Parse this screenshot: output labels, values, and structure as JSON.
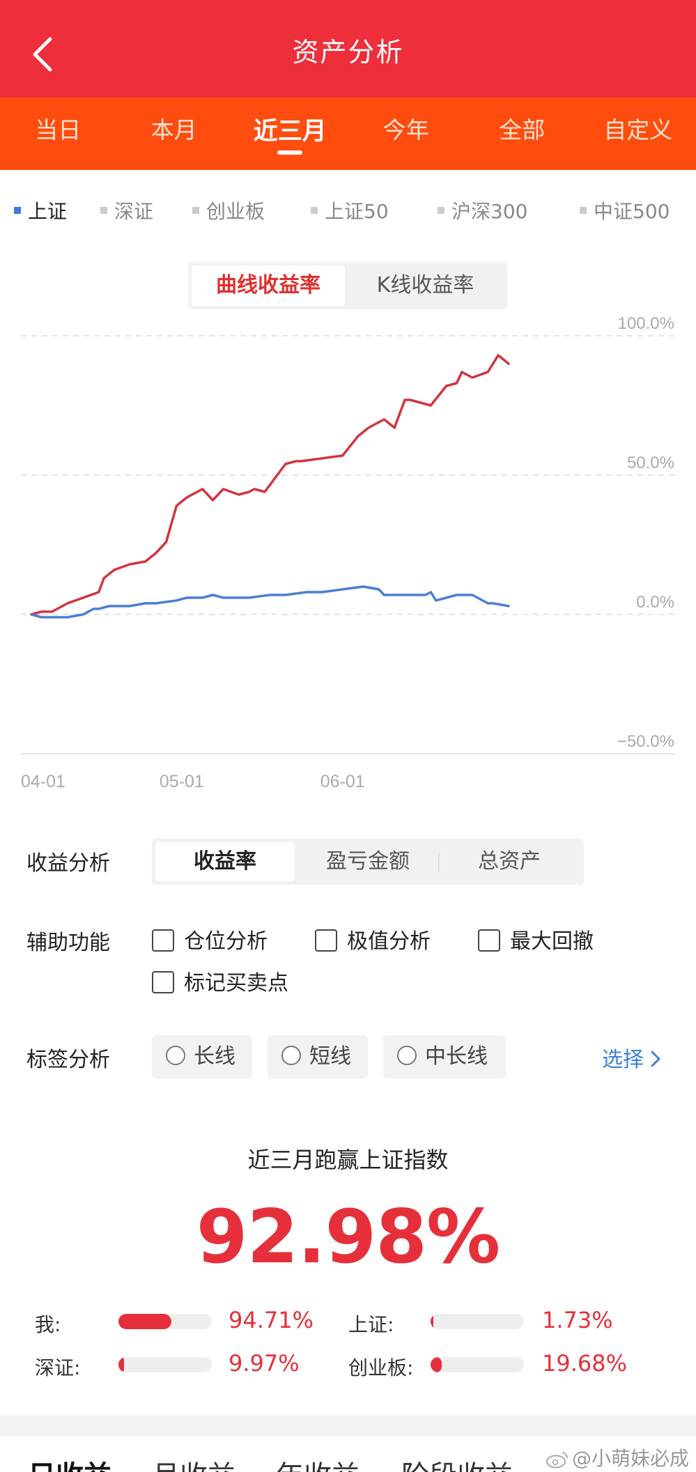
{
  "header": {
    "title": "资产分析"
  },
  "period_tabs": [
    "当日",
    "本月",
    "近三月",
    "今年",
    "全部",
    "自定义"
  ],
  "period_active": 2,
  "index_tabs": [
    "上证",
    "深证",
    "创业板",
    "上证50",
    "沪深300",
    "中证500"
  ],
  "index_active": 0,
  "chart_toggle": {
    "curve": "曲线收益率",
    "kline": "K线收益率"
  },
  "chart_data": {
    "type": "line",
    "y_tick_labels": [
      "100.0%",
      "50.0%",
      "0.0%",
      "−50.0%"
    ],
    "y_ticks": [
      100,
      50,
      0,
      -50
    ],
    "ylim": [
      -50,
      100
    ],
    "x_tick_labels": [
      "04-01",
      "05-01",
      "06-01"
    ],
    "x_ticks": [
      0,
      31,
      62
    ],
    "xlim": [
      0,
      94
    ],
    "grid": true,
    "series": [
      {
        "color": "#d2343f",
        "x": [
          2,
          4,
          6,
          9,
          12,
          15,
          16,
          18,
          21,
          24,
          26,
          27,
          28,
          30,
          32,
          35,
          37,
          39,
          42,
          44,
          45,
          47,
          51,
          53,
          54,
          58,
          62,
          65,
          67,
          70,
          72,
          74,
          75,
          77,
          79,
          82,
          84,
          85,
          87,
          90,
          92,
          94
        ],
        "y": [
          0,
          1,
          1,
          4,
          6,
          8,
          13,
          16,
          18,
          19,
          22,
          24,
          26,
          39,
          42,
          45,
          41,
          45,
          43,
          44,
          45,
          44,
          54,
          55,
          55,
          56,
          57,
          64,
          67,
          70,
          67,
          77,
          77,
          76,
          75,
          82,
          83,
          87,
          85,
          87,
          93,
          90
        ]
      },
      {
        "color": "#4a7fd0",
        "x": [
          2,
          4,
          6,
          9,
          12,
          14,
          15,
          17,
          21,
          24,
          26,
          30,
          32,
          35,
          37,
          39,
          42,
          44,
          48,
          51,
          55,
          58,
          62,
          66,
          69,
          70,
          72,
          74,
          78,
          79,
          80,
          82,
          84,
          87,
          90,
          91,
          94
        ],
        "y": [
          0,
          -1,
          -1,
          -1,
          0,
          2,
          2,
          3,
          3,
          4,
          4,
          5,
          6,
          6,
          7,
          6,
          6,
          6,
          7,
          7,
          8,
          8,
          9,
          10,
          9,
          7,
          7,
          7,
          7,
          8,
          5,
          6,
          7,
          7,
          4,
          4,
          3
        ]
      },
      {
        "color": "#4a7fd0",
        "x": [
          72,
          78,
          84,
          90,
          94
        ],
        "y": [
          7,
          7,
          7,
          4,
          3
        ]
      }
    ]
  },
  "analysis": {
    "label": "收益分析",
    "options": [
      "收益率",
      "盈亏金额",
      "总资产"
    ],
    "active": 0
  },
  "aux": {
    "label": "辅助功能",
    "options": [
      "仓位分析",
      "极值分析",
      "最大回撤",
      "标记买卖点"
    ]
  },
  "tags": {
    "label": "标签分析",
    "options": [
      "长线",
      "短线",
      "中长线"
    ],
    "select": "选择"
  },
  "result": {
    "title": "近三月跑赢上证指数",
    "value": "92.98%"
  },
  "comparison": [
    {
      "label": "我:",
      "value": "94.71%",
      "fraction": 0.57
    },
    {
      "label": "上证:",
      "value": "1.73%",
      "fraction": 0.02
    },
    {
      "label": "深证:",
      "value": "9.97%",
      "fraction": 0.06
    },
    {
      "label": "创业板:",
      "value": "19.68%",
      "fraction": 0.12
    }
  ],
  "bottom_tabs": [
    "日收益",
    "月收益",
    "年收益",
    "阶段收益"
  ],
  "watermark": "@小萌妹必成",
  "colors": {
    "header": "#ec2f3b",
    "period_bar": "#ff4d0f",
    "accent_red": "#e5303b",
    "link_blue": "#3a82d9",
    "index_active": "#3f78e0"
  }
}
